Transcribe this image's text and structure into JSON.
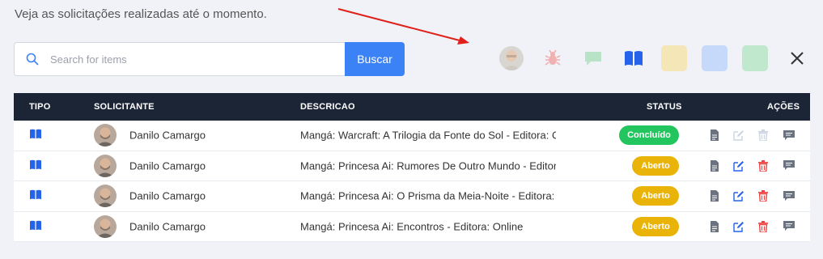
{
  "page": {
    "subtitle": "Veja as solicitações realizadas até o momento."
  },
  "search": {
    "placeholder": "Search for items",
    "button_label": "Buscar"
  },
  "filters": {
    "icons": [
      "user-avatar",
      "bug-icon",
      "chat-icon",
      "book-icon",
      "yellow-swatch",
      "blue-swatch",
      "green-swatch",
      "close-icon"
    ],
    "colors": {
      "yellow": "#f4e6b6",
      "blue": "#c6d9fb",
      "green": "#bfe8cd"
    }
  },
  "table": {
    "headers": {
      "tipo": "TIPO",
      "solicitante": "SOLICITANTE",
      "descricao": "DESCRICAO",
      "status": "STATUS",
      "acoes": "AÇÕES"
    },
    "rows": [
      {
        "tipo": "book-icon",
        "solicitante": "Danilo Camargo",
        "descricao": "Mangá: Warcraft: A Trilogia da Fonte do Sol - Editora: Online",
        "status": "Concluído"
      },
      {
        "tipo": "book-icon",
        "solicitante": "Danilo Camargo",
        "descricao": "Mangá: Princesa Ai: Rumores De Outro Mundo - Editora: Online",
        "status": "Aberto"
      },
      {
        "tipo": "book-icon",
        "solicitante": "Danilo Camargo",
        "descricao": "Mangá: Princesa Ai: O Prisma da Meia-Noite - Editora: Online",
        "status": "Aberto"
      },
      {
        "tipo": "book-icon",
        "solicitante": "Danilo Camargo",
        "descricao": "Mangá: Princesa Ai: Encontros - Editora: Online",
        "status": "Aberto"
      }
    ]
  },
  "colors": {
    "primary": "#3b82f6",
    "header_bg": "#1b2535",
    "status_concluido": "#22c55e",
    "status_aberto": "#eab308",
    "delete": "#ef4444"
  }
}
